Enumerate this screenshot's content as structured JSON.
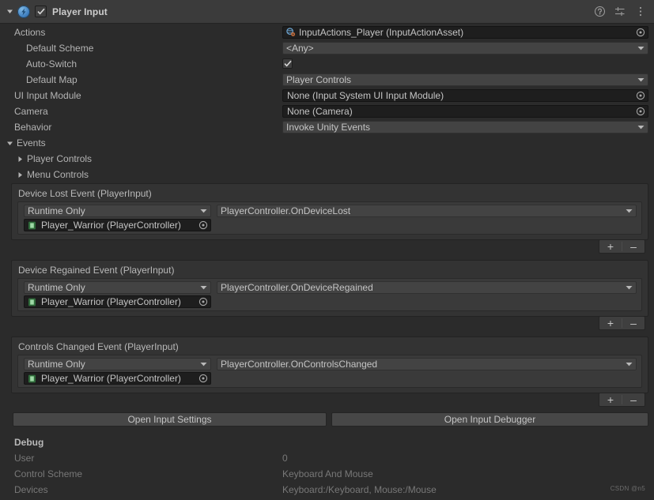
{
  "header": {
    "title": "Player Input",
    "enabled_checkbox": true,
    "icons": {
      "foldout": "triangle-down-icon",
      "component": "player-input-icon",
      "help": "help-icon",
      "preset": "preset-icon",
      "menu": "kebab-menu-icon"
    }
  },
  "properties": [
    {
      "label": "Actions",
      "indent": 0,
      "control": "object",
      "value": "InputActions_Player (InputActionAsset)",
      "has_asset_icon": true
    },
    {
      "label": "Default Scheme",
      "indent": 1,
      "control": "popup",
      "value": "<Any>"
    },
    {
      "label": "Auto-Switch",
      "indent": 1,
      "control": "checkbox",
      "value": true
    },
    {
      "label": "Default Map",
      "indent": 1,
      "control": "popup",
      "value": "Player Controls"
    },
    {
      "label": "UI Input Module",
      "indent": 0,
      "control": "object",
      "value": "None (Input System UI Input Module)"
    },
    {
      "label": "Camera",
      "indent": 0,
      "control": "object",
      "value": "None (Camera)"
    },
    {
      "label": "Behavior",
      "indent": 0,
      "control": "popup",
      "value": "Invoke Unity Events"
    }
  ],
  "events": {
    "root_label": "Events",
    "root_expanded": true,
    "maps": [
      {
        "label": "Player Controls",
        "expanded": false
      },
      {
        "label": "Menu Controls",
        "expanded": false
      }
    ],
    "blocks": [
      {
        "title": "Device Lost Event (PlayerInput)",
        "listener": {
          "call_state": "Runtime Only",
          "method": "PlayerController.OnDeviceLost",
          "object": "Player_Warrior (PlayerController)"
        },
        "add_label": "+",
        "remove_label": "–"
      },
      {
        "title": "Device Regained Event (PlayerInput)",
        "listener": {
          "call_state": "Runtime Only",
          "method": "PlayerController.OnDeviceRegained",
          "object": "Player_Warrior (PlayerController)"
        },
        "add_label": "+",
        "remove_label": "–"
      },
      {
        "title": "Controls Changed Event (PlayerInput)",
        "listener": {
          "call_state": "Runtime Only",
          "method": "PlayerController.OnControlsChanged",
          "object": "Player_Warrior (PlayerController)"
        },
        "add_label": "+",
        "remove_label": "–"
      }
    ]
  },
  "buttons": {
    "open_input_settings": "Open Input Settings",
    "open_input_debugger": "Open Input Debugger"
  },
  "debug": {
    "title": "Debug",
    "rows": [
      {
        "label": "User",
        "value": "0"
      },
      {
        "label": "Control Scheme",
        "value": "Keyboard And Mouse"
      },
      {
        "label": "Devices",
        "value": "Keyboard:/Keyboard, Mouse:/Mouse"
      }
    ]
  },
  "watermark": "CSDN @n5",
  "colors": {
    "background": "#2b2b2b",
    "header": "#3b3b3b",
    "popup_field": "#434343",
    "object_field": "#1e1e1e",
    "event_block": "#333333",
    "text": "#b4b4b4",
    "text_dim": "#787878",
    "accent_icon": "#4f8fd0"
  }
}
